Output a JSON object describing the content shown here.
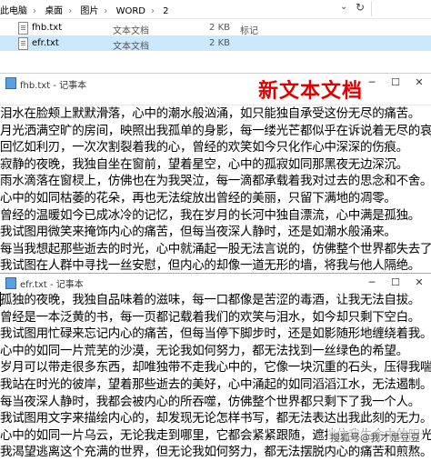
{
  "explorer": {
    "breadcrumbs": [
      "此电脑",
      "桌面",
      "图片",
      "WORD",
      "2"
    ],
    "separator": "›",
    "files": [
      {
        "name": "fhb.txt",
        "type": "文本文档",
        "size": "2 KB",
        "tag": "标记"
      },
      {
        "name": "efr.txt",
        "type": "文本文档",
        "size": "2 KB",
        "tag": ""
      }
    ]
  },
  "banner": "新文本文档",
  "notepad1": {
    "title": "fhb.txt - 记事本",
    "lines": [
      "泪水在脸颊上默默滑落，心中的潮水般汹涌，如只能独自承受这份无尽的痛苦。",
      "月光洒满空旷的房间，映照出我孤单的身影，每一缕光芒都似乎在诉说着无尽的哀伤。",
      "回忆如利刃，一次次割裂着我的心，曾经的欢笑如今只化作心中深深的伤痕。",
      "寂静的夜晚，我独自坐在窗前，望着星空，心中的孤寂如同那黑夜无边深沉。",
      "雨水滴落在窗棂上，仿佛也在为我哭泣，每一滴都承载着我对过去的思念和不舍。",
      "心中的如同枯萎的花朵，再也无法绽放出曾经的美丽，只留下满地的凋零。",
      "曾经的温暖如今已成冰冷的记忆，我在岁月的长河中独自漂流，心中满是孤独。",
      "我试图用微笑来掩饰内心的痛苦，但每当夜深人静时，还是如潮水般涌来。",
      "每当我想起那些逝去的时光，心中就涌起一股无法言说的，仿佛整个世界都失去了色彩。",
      "我试图在人群中寻找一丝安慰，但内心的却像一道无形的墙，将我与他人隔绝。"
    ]
  },
  "notepad2": {
    "title": "efr.txt - 记事本",
    "lines": [
      "孤独的夜晚，我独自品味着的滋味，每一口都像是苦涩的毒酒，让我无法自拔。",
      "曾经是一本泛黄的书，每一页都记载着我们的欢笑与泪水，如今却只剩下空白。",
      "我试图用忙碌来忘记内心的痛苦，但每当停下脚步时，还是如影随形地缠绕着我。",
      "心中的如同一片荒芜的沙漠，无论我如何努力，都无法找到一丝绿色的希望。",
      "岁月可以带走很多东西，却唯独带不走我心中的，它像一块沉重的石头，压得我喘不过气来。",
      "我站在时光的彼岸，望着那些逝去的美好，心中涌起的如同滔滔江水，无法遏制。",
      "每当夜深人静时，我都会被内心的所吞噬，仿佛整个世界都只剩下了我一个人。",
      "我试图用文字来描绘内心的，却发现无论怎样书写，都无法表达出我此刻的无力。",
      "心中的如同一片乌云，无论我走到哪里，它都会紧紧跟随，遮挡住我生命中的阳光。",
      "我渴望逃离这个充满的世界，但无论我如何努力，都无法摆脱内心的痛苦和煎熬。"
    ]
  },
  "watermark": "搜狐号@我才是豆豆"
}
